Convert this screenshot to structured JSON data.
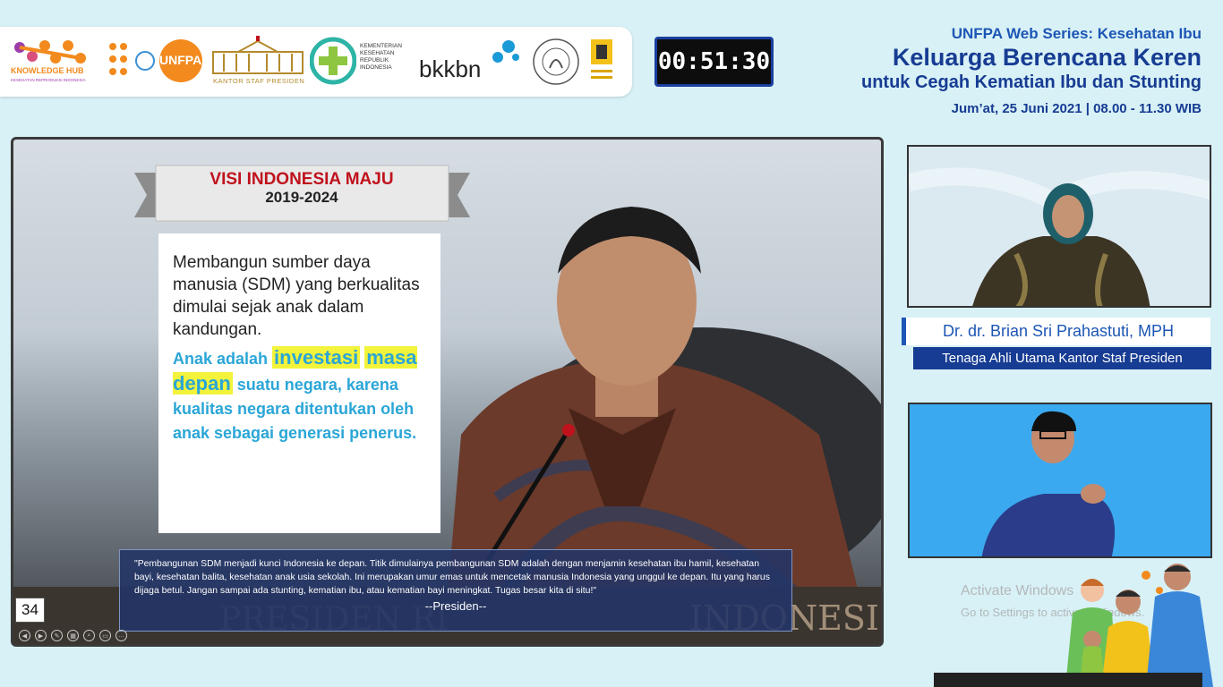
{
  "logos": {
    "knowledge_hub": "KNOWLEDGE HUB",
    "knowledge_hub_sub": "KESEHATAN REPRODUKSI INDONESIA",
    "unfpa": "UNFPA",
    "ksp": "KANTOR STAF PRESIDEN",
    "kemenkes": "KEMENTERIAN\nKESEHATAN\nREPUBLIK\nINDONESIA",
    "bkkbn": "bkkbn"
  },
  "timer": "00:51:30",
  "header": {
    "series": "UNFPA Web Series: Kesehatan Ibu",
    "headline": "Keluarga Berencana Keren",
    "subhead": "untuk Cegah Kematian Ibu dan Stunting",
    "dateline": "Jum’at, 25 Juni 2021  |  08.00 - 11.30 WIB"
  },
  "slide": {
    "banner_title": "VISI INDONESIA MAJU",
    "banner_years": "2019-2024",
    "card_paragraph": "Membangun sumber daya manusia (SDM) yang berkualitas dimulai sejak anak dalam kandungan.",
    "card_c_prefix": "Anak adalah ",
    "card_c_highlight1": "investasi",
    "card_c_highlight2": "masa depan",
    "card_c_suffix": " suatu negara, karena kualitas negara ditentukan oleh anak sebagai generasi penerus.",
    "quote": "\"Pembangunan SDM menjadi kunci Indonesia ke depan. Titik dimulainya pembangunan SDM adalah dengan menjamin kesehatan ibu hamil, kesehatan bayi, kesehatan balita, kesehatan anak usia sekolah. Ini merupakan umur emas untuk mencetak manusia Indonesia yang unggul ke depan. Itu yang harus dijaga betul. Jangan sampai ada stunting, kematian ibu, atau kematian bayi meningkat. Tugas besar kita di situ!\"",
    "quote_signature": "--Presiden--",
    "podium_text": "PRESIDEN RI",
    "podium_text2": "INDONESI",
    "slide_number": "34"
  },
  "speaker": {
    "name": "Dr. dr. Brian Sri Prahastuti, MPH",
    "role": "Tenaga Ahli Utama Kantor Staf Presiden"
  },
  "watermark": {
    "line1": "Activate Windows",
    "line2": "Go to Settings to activate Windows."
  },
  "colors": {
    "background": "#d8f1f6",
    "brand_blue": "#173c93",
    "accent_blue": "#1d56b5",
    "highlight_yellow": "#f2f33a",
    "card_text_blue": "#2ba6d7",
    "banner_red": "#c0121c"
  }
}
